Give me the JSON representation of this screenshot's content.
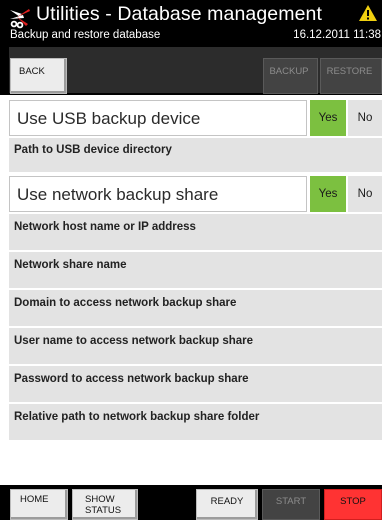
{
  "header": {
    "logo_icon": "scissors-logo-icon",
    "title": "Utilities - Database management",
    "subtitle": "Backup and restore database",
    "datetime": "16.12.2011 11:38",
    "warning_icon": "warning-triangle-icon",
    "warning_color": "#f0d010"
  },
  "toolbar": {
    "back_label": "BACK",
    "backup_label": "BACKUP",
    "restore_label": "RESTORE"
  },
  "settings": {
    "usb": {
      "label": "Use USB backup device",
      "yes_label": "Yes",
      "no_label": "No",
      "selected": "Yes"
    },
    "usb_path_label": "Path to USB device directory",
    "network": {
      "label": "Use network backup share",
      "yes_label": "Yes",
      "no_label": "No",
      "selected": "Yes"
    },
    "fields": [
      "Network host name or IP address",
      "Network share name",
      "Domain to access network backup share",
      "User name to access network backup share",
      "Password to access network backup share",
      "Relative path to network backup share folder"
    ]
  },
  "footer": {
    "home_label": "HOME",
    "show_status_line1": "SHOW",
    "show_status_line2": "STATUS",
    "ready_label": "READY",
    "start_label": "START",
    "stop_label": "STOP"
  },
  "colors": {
    "selected_yes": "#7cc040",
    "stop": "#ff3333",
    "header_bg": "#000000",
    "row_bg": "#e3e3e3"
  }
}
